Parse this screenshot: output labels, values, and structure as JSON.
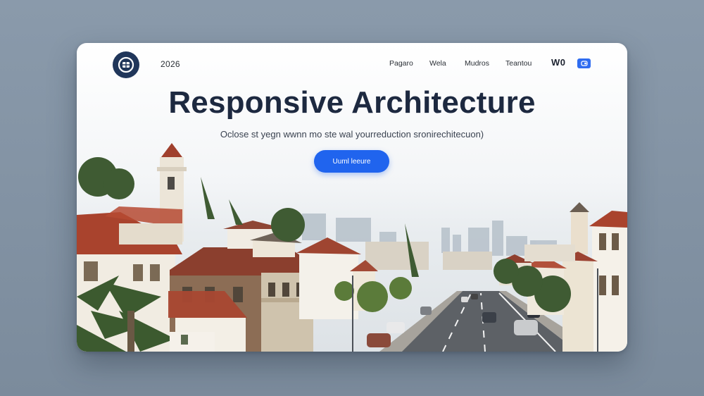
{
  "nav": {
    "year": "2026",
    "links": [
      "Pagaro",
      "Wela",
      "Mudros",
      "Teantou"
    ],
    "right_label": "W0"
  },
  "hero": {
    "title": "Responsive Architecture",
    "subtitle": "Oclose st yegn wwnn mo ste wal  yourreduction sronirechitecuon)",
    "cta_label": "Uuml leeure"
  },
  "colors": {
    "accent": "#2064ee",
    "title": "#1d2940",
    "logo_bg": "#20365a",
    "page_bg": "#8a9aab"
  },
  "icons": {
    "logo": "brand-logo-icon",
    "toggle": "toggle-icon"
  }
}
